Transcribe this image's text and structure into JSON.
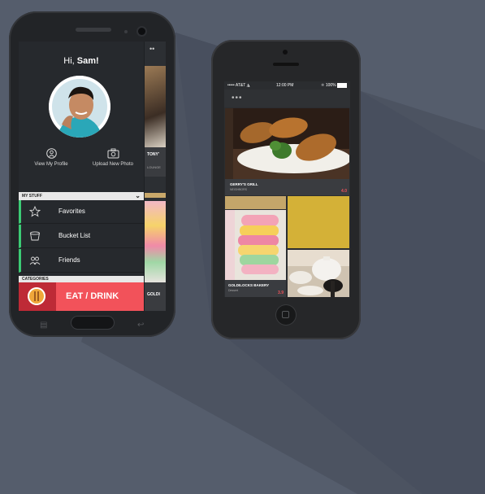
{
  "android": {
    "greeting_prefix": "Hi, ",
    "greeting_name": "Sam!",
    "view_profile_label": "View My Profile",
    "upload_photo_label": "Upload New Photo",
    "my_stuff_header": "MY STUFF",
    "menu_items": [
      {
        "label": "Favorites",
        "icon": "star-icon"
      },
      {
        "label": "Bucket List",
        "icon": "bucket-icon"
      },
      {
        "label": "Friends",
        "icon": "friends-icon"
      }
    ],
    "categories_header": "CATEGORIES",
    "category_label": "EAT / DRINK",
    "peek_labels": [
      "TONY'",
      "LOUNGE",
      "GOLDI"
    ],
    "peek_menu_icon": "menu-dots-icon"
  },
  "iphone": {
    "carrier": "AT&T",
    "time": "12:00 PM",
    "battery": "100%",
    "menu_icon": "menu-dots-icon",
    "cards": [
      {
        "title": "GERRY'S GRILL",
        "subtitle": "NEIGHBORS",
        "score": "4.0"
      },
      {
        "title": "GOLDILOCKS BAKERY",
        "subtitle": "Dessert",
        "score": "3.9"
      }
    ]
  },
  "colors": {
    "background": "#555d6c",
    "accent_green": "#3ccb75",
    "accent_red": "#f2525a",
    "mustard": "#d4b137"
  }
}
